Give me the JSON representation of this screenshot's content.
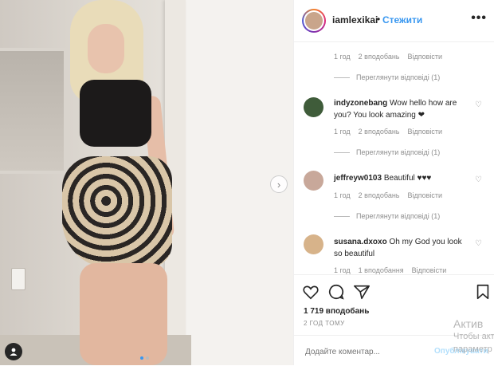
{
  "header": {
    "username": "iamlexikai",
    "separator": "•",
    "follow_label": "Стежити",
    "more_label": "•••"
  },
  "comments": [
    {
      "type": "meta-only",
      "time": "1 год",
      "likes": "2 вподобань",
      "reply": "Відповісти",
      "view_replies": "Переглянути відповіді (1)"
    },
    {
      "username": "indyzonebang",
      "text": "Wow hello how are you? You look amazing ❤",
      "time": "1 год",
      "likes": "2 вподобань",
      "reply": "Відповісти",
      "view_replies": "Переглянути відповіді (1)",
      "avatar_color": "#3f5c3a"
    },
    {
      "username": "jeffreyw0103",
      "text": "Beautiful ♥♥♥",
      "time": "1 год",
      "likes": "2 вподобань",
      "reply": "Відповісти",
      "view_replies": "Переглянути відповіді (1)",
      "avatar_color": "#c8a89a"
    },
    {
      "username": "susana.dxoxo",
      "text": "Oh my God you look so beautiful",
      "time": "1 год",
      "likes": "1 вподобання",
      "reply": "Відповісти",
      "avatar_color": "#d7b38a"
    }
  ],
  "actions": {
    "likes_count": "1 719 вподобань",
    "time_ago": "2 ГОД ТОМУ"
  },
  "add_comment": {
    "placeholder": "Додайте коментар...",
    "publish_label": "Опублікувати"
  },
  "watermark": {
    "line1": "Актив",
    "line2": "Чтобы акт",
    "line3": "параметр"
  },
  "colors": {
    "accent": "#3897f0",
    "text": "#262626",
    "muted": "#8e8e8e"
  }
}
